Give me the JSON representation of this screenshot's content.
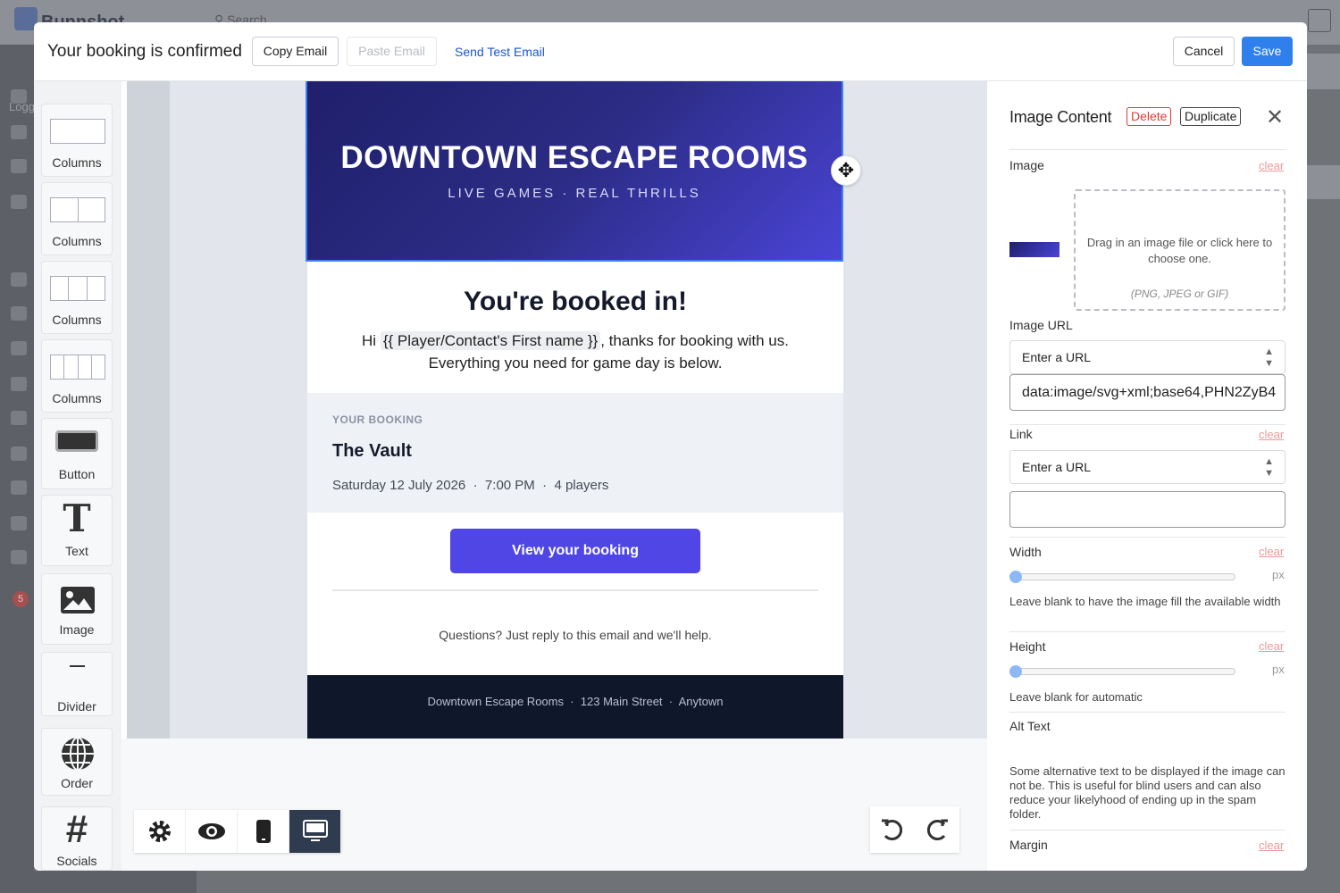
{
  "background": {
    "brand": "Bunnshot",
    "search_placeholder": "Search",
    "logged_label": "Logg",
    "notification_count": "5"
  },
  "header": {
    "title": "Your booking is confirmed",
    "copy_email": "Copy Email",
    "paste_email": "Paste Email",
    "send_test": "Send Test Email",
    "cancel": "Cancel",
    "save": "Save"
  },
  "tools": [
    {
      "label": "Columns",
      "icon": "one-column-icon"
    },
    {
      "label": "Columns",
      "icon": "two-columns-icon"
    },
    {
      "label": "Columns",
      "icon": "three-columns-icon"
    },
    {
      "label": "Columns",
      "icon": "four-columns-icon"
    },
    {
      "label": "Button",
      "icon": "button-icon"
    },
    {
      "label": "Text",
      "icon": "text-icon"
    },
    {
      "label": "Image",
      "icon": "image-icon"
    },
    {
      "label": "Divider",
      "icon": "divider-icon"
    },
    {
      "label": "Order",
      "icon": "globe-icon"
    },
    {
      "label": "Socials",
      "icon": "hashtag-icon"
    }
  ],
  "email": {
    "hero_title": "DOWNTOWN ESCAPE ROOMS",
    "hero_subtitle": "LIVE GAMES · REAL THRILLS",
    "heading": "You're booked in!",
    "greeting_pre": "Hi",
    "merge_tag": "{{  Player/Contact's First name }}",
    "greeting_post": ", thanks for booking with us.",
    "greeting_line2": "Everything you need for game day is below.",
    "booking_label": "YOUR BOOKING",
    "room": "The Vault",
    "details": "Saturday 12 July 2026  ·  7:00 PM  ·  4 players",
    "cta": "View your booking",
    "questions": "Questions? Just reply to this email and we'll help.",
    "footer": "Downtown Escape Rooms  ·  123 Main Street  ·  Anytown"
  },
  "panel": {
    "title": "Image Content",
    "delete": "Delete",
    "duplicate": "Duplicate",
    "image_label": "Image",
    "clear": "clear",
    "dropzone_text": "Drag in an image file or click here to choose one.",
    "dropzone_types": "(PNG, JPEG or GIF)",
    "image_url_label": "Image URL",
    "url_select": "Enter a URL",
    "image_url_value": "data:image/svg+xml;base64,PHN2ZyB4",
    "link_label": "Link",
    "link_select": "Enter a URL",
    "link_value": "",
    "width_label": "Width",
    "width_value": 0,
    "px": "px",
    "width_help": "Leave blank to have the image fill the available width",
    "height_label": "Height",
    "height_value": 0,
    "height_help": "Leave blank for automatic",
    "alt_label": "Alt Text",
    "alt_help": "Some alternative text to be displayed if the image can not be. This is useful for blind users and can also reduce your likelyhood of ending up in the spam folder.",
    "margin_label": "Margin"
  },
  "colors": {
    "primary": "#2f80ed",
    "cta": "#4f46e5",
    "hero_start": "#1f1f6b",
    "hero_end": "#4a44d6",
    "footer": "#0f172a",
    "delete": "#e03b3b"
  }
}
